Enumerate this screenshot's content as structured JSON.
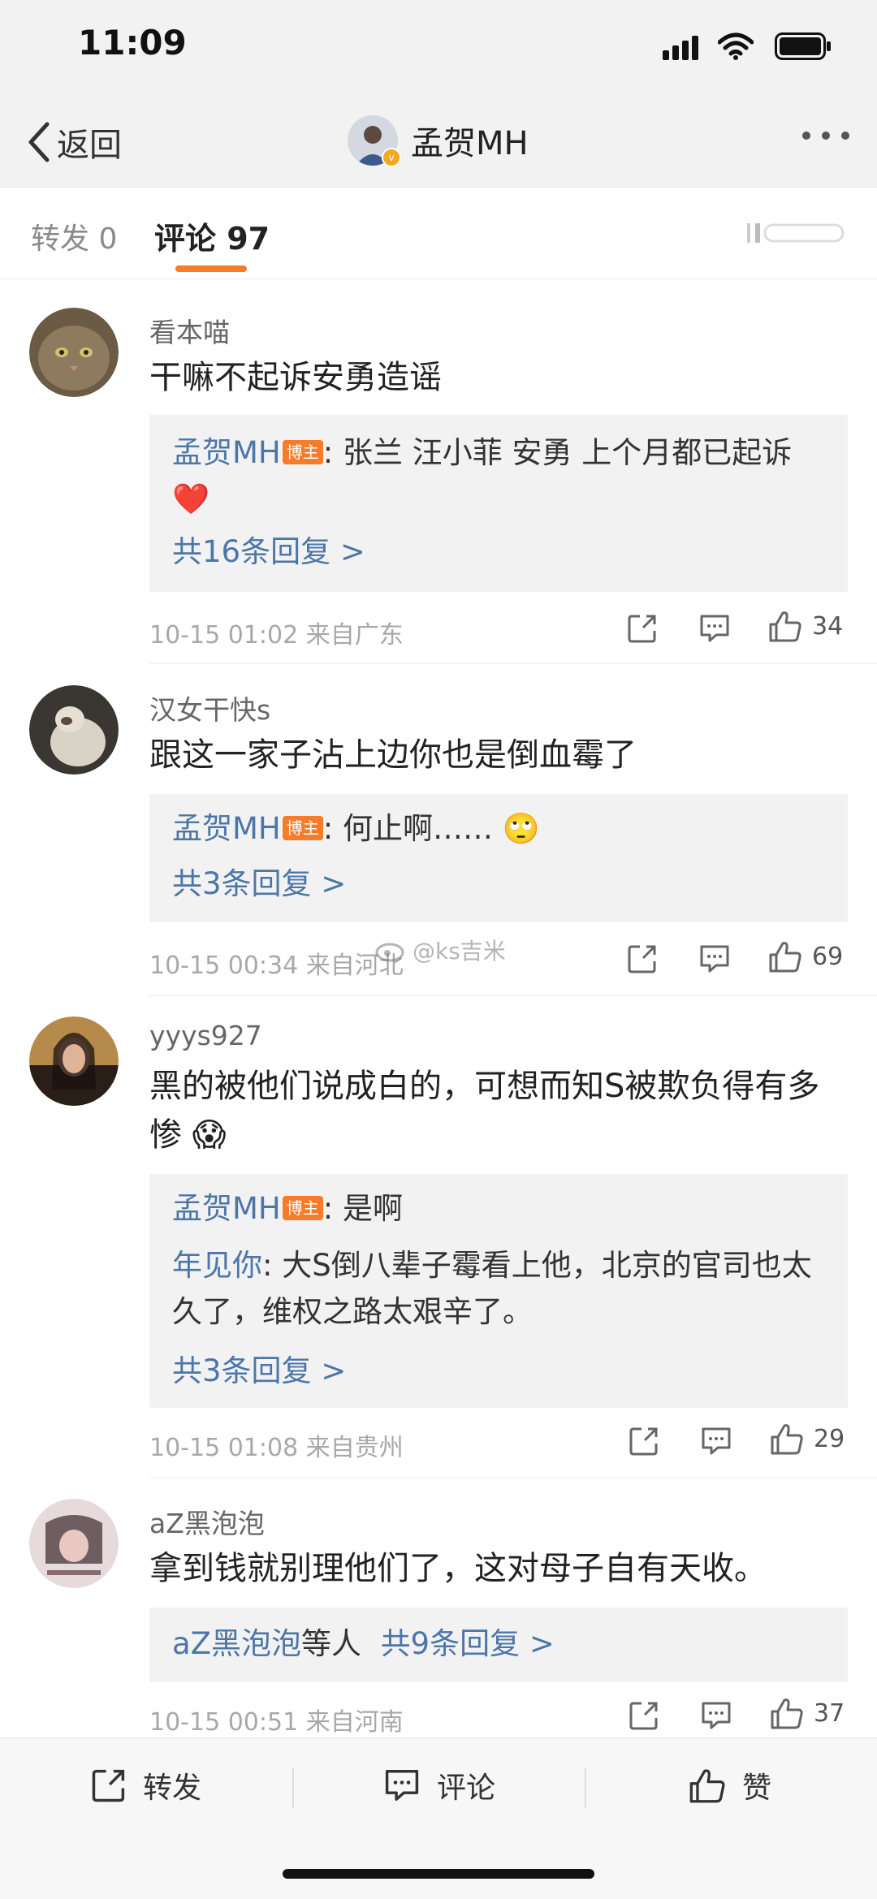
{
  "status": {
    "time": "11:09"
  },
  "nav": {
    "back_label": "返回",
    "account_name": "孟贺MH"
  },
  "tabs": {
    "repost": "转发 0",
    "comments": "评论 97"
  },
  "comments": [
    {
      "user": "看本喵",
      "text": "干嘛不起诉安勇造谣",
      "reply": {
        "author": "孟贺MH",
        "badge": "博主",
        "text": ": 张兰 汪小菲 安勇 上个月都已起诉 ❤️"
      },
      "count": "共16条回复 >",
      "meta": "10-15 01:02 来自广东",
      "likes": "34"
    },
    {
      "user": "汉女干快s",
      "text": "跟这一家子沾上边你也是倒血霉了",
      "reply": {
        "author": "孟贺MH",
        "badge": "博主",
        "text": ": 何止啊…… 🙄"
      },
      "count": "共3条回复 >",
      "meta": "10-15 00:34 来自河北",
      "likes": "69"
    },
    {
      "user": "yyys927",
      "text": "黑的被他们说成白的，可想而知S被欺负得有多惨 😱",
      "reply": {
        "author": "孟贺MH",
        "badge": "博主",
        "text": ": 是啊"
      },
      "reply2": {
        "author": "年见你",
        "text": ": 大S倒八辈子霉看上他，北京的官司也太久了，维权之路太艰辛了。"
      },
      "count": "共3条回复 >",
      "meta": "10-15 01:08 来自贵州",
      "likes": "29"
    },
    {
      "user": "aZ黑泡泡",
      "text": "拿到钱就别理他们了，这对母子自有天收。",
      "reply_owner": "aZ黑泡泡",
      "reply_owner_suffix": "等人",
      "count": "共9条回复 >",
      "meta": "10-15 00:51 来自河南",
      "likes": "37"
    }
  ],
  "watermark": "@ks吉米",
  "bottom": {
    "repost": "转发",
    "comment": "评论",
    "like": "赞"
  },
  "colors": {
    "accent": "#f57c2a",
    "link": "#4d76a8"
  }
}
